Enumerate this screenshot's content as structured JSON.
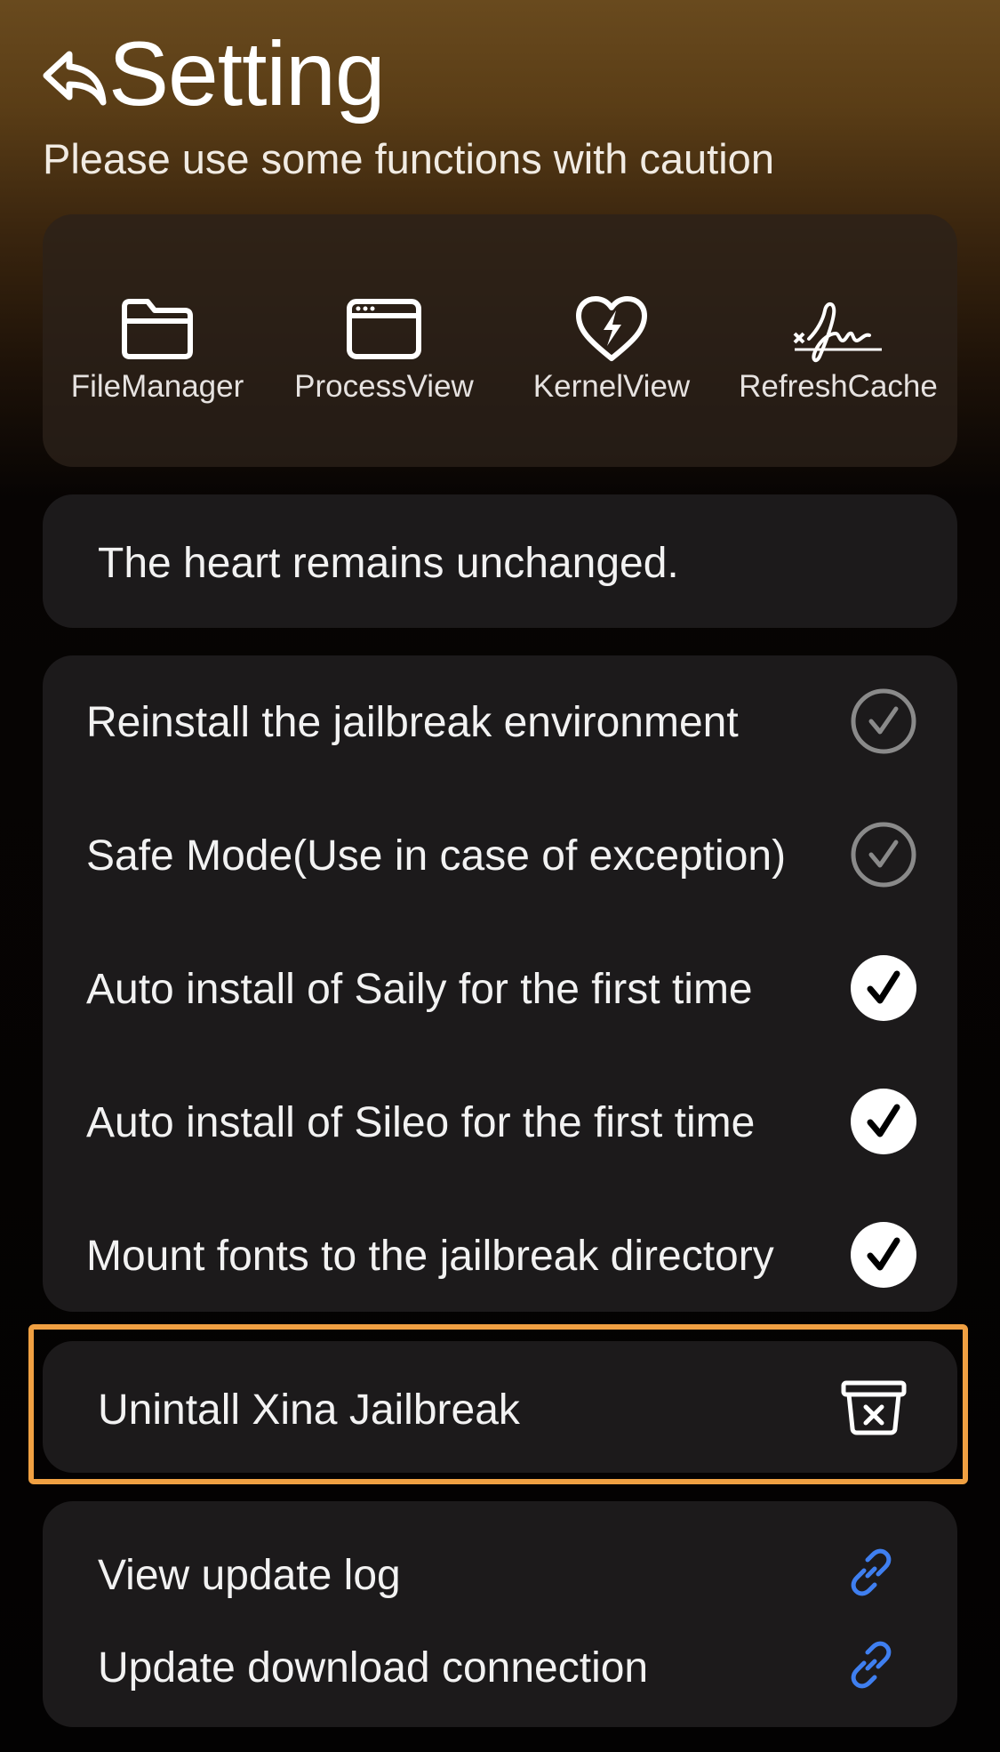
{
  "header": {
    "title": "Setting",
    "subtitle": "Please use some functions with caution"
  },
  "tools": [
    {
      "label": "FileManager",
      "icon": "folder-icon"
    },
    {
      "label": "ProcessView",
      "icon": "window-icon"
    },
    {
      "label": "KernelView",
      "icon": "heart-bolt-icon"
    },
    {
      "label": "RefreshCache",
      "icon": "signature-icon"
    }
  ],
  "quote": "The heart remains unchanged.",
  "options": [
    {
      "label": "Reinstall the jailbreak environment",
      "checked": false
    },
    {
      "label": "Safe Mode(Use in case of exception)",
      "checked": false
    },
    {
      "label": "Auto install of Saily for the first time",
      "checked": true
    },
    {
      "label": "Auto install of Sileo for the first time",
      "checked": true
    },
    {
      "label": "Mount fonts to the jailbreak directory",
      "checked": true
    }
  ],
  "uninstall": {
    "label": "Unintall Xina Jailbreak"
  },
  "links": [
    {
      "label": "View update log"
    },
    {
      "label": "Update download connection"
    }
  ],
  "colors": {
    "accent_link": "#3f7ff0",
    "highlight": "#f0a042"
  }
}
